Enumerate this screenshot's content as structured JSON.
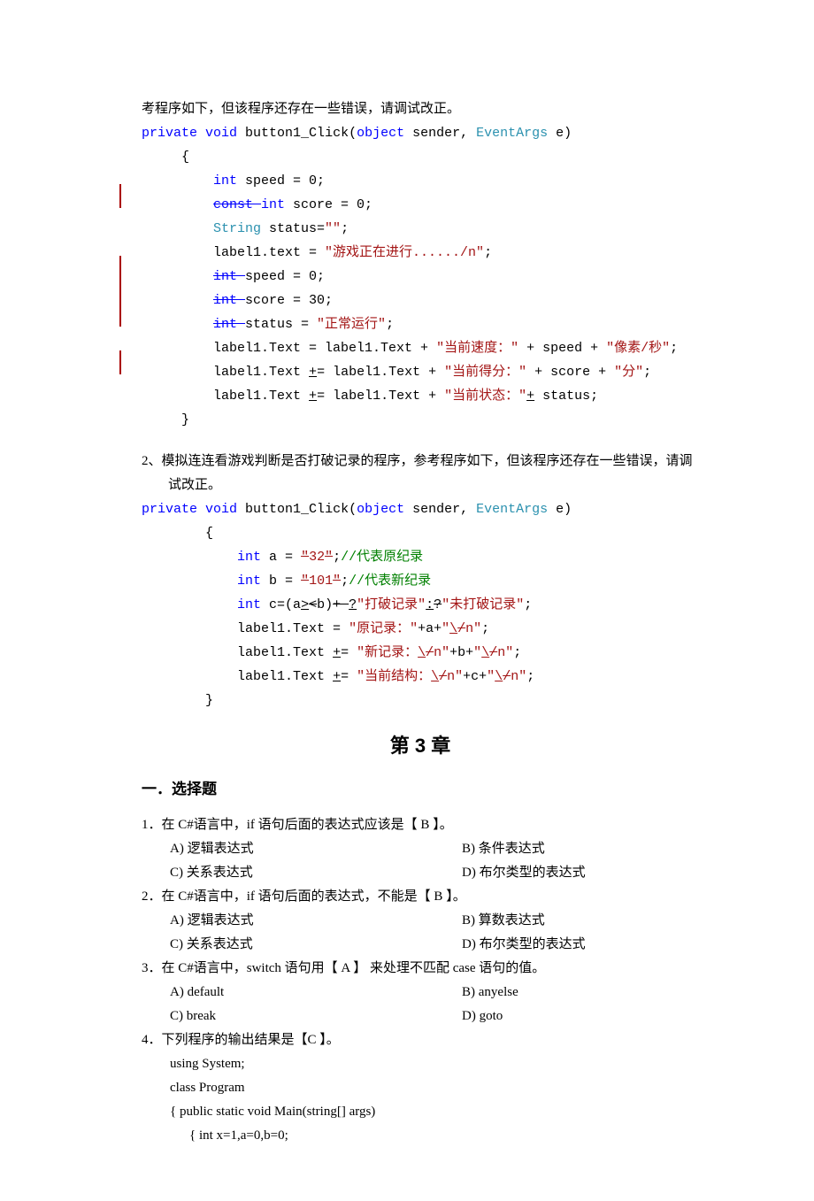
{
  "intro_line": "考程序如下，但该程序还存在一些错误，请调试改正。",
  "code1": {
    "sig_private": "private",
    "sig_void": "void",
    "sig_name": " button1_Click(",
    "sig_object": "object",
    "sig_sender": " sender, ",
    "sig_eventargs": "EventArgs",
    "sig_e": " e)",
    "brace_open": "{",
    "l_int_kw": "int",
    "l_speed": " speed = 0;",
    "l_const_kw": "const ",
    "l_const_int": "int",
    "l_score": " score = 0;",
    "l_string_kw": "String",
    "l_status": " status=",
    "l_status_val": "\"\"",
    "l_status_semi": ";",
    "l_label1a": "label1.text = ",
    "l_label1a_val": "\"游戏正在进行....../n\"",
    "l_label1a_semi": ";",
    "l_int_speed_kw": "int ",
    "l_speed2": "speed = 0;",
    "l_int_score_kw": "int ",
    "l_score2": "score = 30;",
    "l_int_status_kw": "int ",
    "l_status2": "status = ",
    "l_status2_val": "\"正常运行\"",
    "l_status2_semi": ";",
    "l_lbl_b1": "label1.Text = label1.Text + ",
    "l_lbl_b1_s1": "\"当前速度：\"",
    "l_lbl_b1_mid": " + speed + ",
    "l_lbl_b1_s2": "\"像素/秒\"",
    "l_lbl_b1_semi": ";",
    "l_lbl_c1a": "label1.Text ",
    "l_lbl_c1_op": "+",
    "l_lbl_c1b": "= label1.Text + ",
    "l_lbl_c1_s1": "\"当前得分：\"",
    "l_lbl_c1_mid": " + score + ",
    "l_lbl_c1_s2": "\"分\"",
    "l_lbl_c1_semi": ";",
    "l_lbl_d1a": "label1.Text ",
    "l_lbl_d1_op": "+",
    "l_lbl_d1b": "= label1.Text + ",
    "l_lbl_d1_s1": "\"当前状态：\"",
    "l_lbl_d1_plus": "+",
    "l_lbl_d1_mid": " status;",
    "brace_close": "}"
  },
  "q2_text": "2、模拟连连看游戏判断是否打破记录的程序，参考程序如下，但该程序还存在一些错误，请调试改正。",
  "code2": {
    "sig_private": "private",
    "sig_void": "void",
    "sig_name": " button1_Click(",
    "sig_object": "object",
    "sig_sender": " sender, ",
    "sig_eventargs": "EventArgs",
    "sig_e": " e)",
    "brace_open": "{",
    "l_int_kw": "int",
    "l_a_pre": " a = ",
    "l_a_q1": "\"",
    "l_a_val": "32",
    "l_a_q2": "\"",
    "l_a_semi": ";",
    "l_a_comment": "//代表原纪录",
    "l_b_pre": " b = ",
    "l_b_q1": "\"",
    "l_b_val": "101",
    "l_b_q2": "\"",
    "l_b_semi": ";",
    "l_b_comment": "//代表新纪录",
    "l_c_pre": " c=(a",
    "l_c_op": ">",
    "l_c_orig": "<",
    "l_c_mid": "b)",
    "l_c_strike": "+ ",
    "l_c_q": "?",
    "l_c_s1": "\"打破记录\"",
    "l_c_colon": ":",
    "l_c_strike2": "?",
    "l_c_s2": "\"未打破记录\"",
    "l_c_semi": ";",
    "l_lbl1_a": "label1.Text = ",
    "l_lbl1_s1": "\"原记录：\"",
    "l_lbl1_mid": "+a+",
    "l_lbl1_s2a": "\"",
    "l_lbl1_bs": "\\",
    "l_lbl1_strike": "/",
    "l_lbl1_s2b": "n\"",
    "l_lbl1_semi": ";",
    "l_lbl2_a": "label1.Text ",
    "l_lbl2_op": "+",
    "l_lbl2_b": "= ",
    "l_lbl2_s1a": "\"新记录：",
    "l_lbl2_mid": "+b+",
    "l_lbl2_semi": ";",
    "l_lbl3_a": "label1.Text ",
    "l_lbl3_op": "+",
    "l_lbl3_b": "= ",
    "l_lbl3_s1a": "\"当前结构：",
    "l_lbl3_mid": "+c+",
    "l_lbl3_semi": ";",
    "brace_close": "}"
  },
  "chapter": "第 3 章",
  "section": "一．选择题",
  "mc": {
    "q1": {
      "stem_a": "1．在 C#语言中，if 语句后面的表达式应该是【  ",
      "ans": "B",
      "stem_b": "  】。",
      "A": "A)  逻辑表达式",
      "B": "B)  条件表达式",
      "C": "C)  关系表达式",
      "D": "D)  布尔类型的表达式"
    },
    "q2": {
      "stem_a": "2．在 C#语言中，if 语句后面的表达式，不能是【  ",
      "ans": "B",
      "stem_b": " 】。",
      "A": "A)  逻辑表达式",
      "B": "B)  算数表达式",
      "C": "C)  关系表达式",
      "D": "D)  布尔类型的表达式"
    },
    "q3": {
      "stem_a": "3．在 C#语言中，switch 语句用【  ",
      "ans": "A",
      "stem_b": " 】 来处理不匹配 case 语句的值。",
      "A": "A) default",
      "B": "B) anyelse",
      "C": "C) break",
      "D": "D) goto"
    },
    "q4": {
      "stem_a": "4．下列程序的输出结果是【",
      "ans": "C ",
      "stem_b": "】。",
      "l1": "using System;",
      "l2": "class Program",
      "l3": "{     public static void Main(string[] args)",
      "l4": "     {      int x=1,a=0,b=0;"
    }
  }
}
